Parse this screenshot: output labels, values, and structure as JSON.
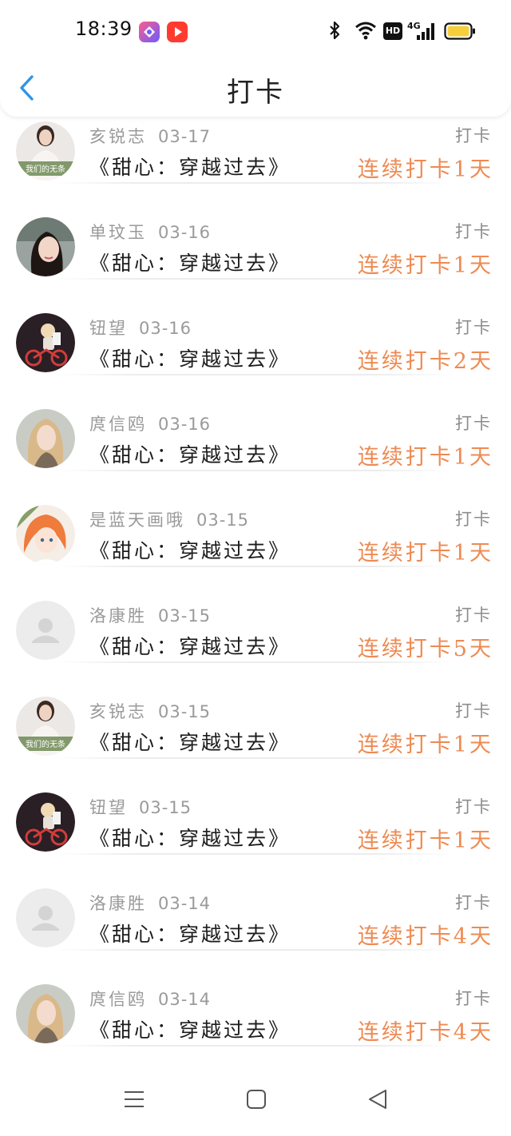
{
  "status_bar": {
    "time": "18:39",
    "icons": [
      "app-badge-icon",
      "video-app-icon",
      "bluetooth-icon",
      "wifi-icon",
      "hd-icon",
      "signal-4g-icon",
      "battery-icon"
    ],
    "hd_label": "HD",
    "network_label": "4G"
  },
  "header": {
    "back_icon": "chevron-left-icon",
    "title": "打卡"
  },
  "colors": {
    "streak": "#ee8a52",
    "back": "#2f95e8",
    "meta": "#9a9a9a"
  },
  "checkins": [
    {
      "name": "亥锐志",
      "date": "03-17",
      "book": "《甜心：穿越过去》",
      "type": "打卡",
      "streak": "连续打卡1天",
      "avatar": "photo-woman-banner"
    },
    {
      "name": "单玟玉",
      "date": "03-16",
      "book": "《甜心：穿越过去》",
      "type": "打卡",
      "streak": "连续打卡1天",
      "avatar": "photo-woman-dark-hair"
    },
    {
      "name": "钮望",
      "date": "03-16",
      "book": "《甜心：穿越过去》",
      "type": "打卡",
      "streak": "连续打卡2天",
      "avatar": "photo-child-bike"
    },
    {
      "name": "庹信鸥",
      "date": "03-16",
      "book": "《甜心：穿越过去》",
      "type": "打卡",
      "streak": "连续打卡1天",
      "avatar": "photo-woman-blonde"
    },
    {
      "name": "是蓝天画哦",
      "date": "03-15",
      "book": "《甜心：穿越过去》",
      "type": "打卡",
      "streak": "连续打卡1天",
      "avatar": "anime-girl-orange-hair"
    },
    {
      "name": "洛康胜",
      "date": "03-15",
      "book": "《甜心：穿越过去》",
      "type": "打卡",
      "streak": "连续打卡5天",
      "avatar": "default-user-placeholder"
    },
    {
      "name": "亥锐志",
      "date": "03-15",
      "book": "《甜心：穿越过去》",
      "type": "打卡",
      "streak": "连续打卡1天",
      "avatar": "photo-woman-banner"
    },
    {
      "name": "钮望",
      "date": "03-15",
      "book": "《甜心：穿越过去》",
      "type": "打卡",
      "streak": "连续打卡1天",
      "avatar": "photo-child-bike"
    },
    {
      "name": "洛康胜",
      "date": "03-14",
      "book": "《甜心：穿越过去》",
      "type": "打卡",
      "streak": "连续打卡4天",
      "avatar": "default-user-placeholder"
    },
    {
      "name": "庹信鸥",
      "date": "03-14",
      "book": "《甜心：穿越过去》",
      "type": "打卡",
      "streak": "连续打卡4天",
      "avatar": "photo-woman-blonde"
    }
  ],
  "avatar_banner_text": "我们的无条",
  "nav_bar": {
    "buttons": [
      "menu-icon",
      "home-square-icon",
      "back-triangle-icon"
    ]
  }
}
